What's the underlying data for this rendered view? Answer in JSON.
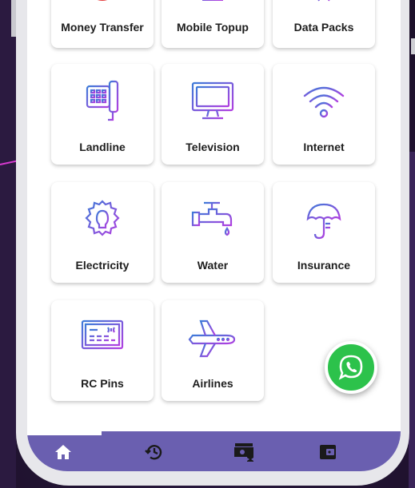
{
  "services": [
    {
      "label": "Money Transfer",
      "icon": "money-transfer-icon"
    },
    {
      "label": "Mobile Topup",
      "icon": "mobile-topup-icon"
    },
    {
      "label": "Data Packs",
      "icon": "data-packs-icon"
    },
    {
      "label": "Landline",
      "icon": "landline-phone-icon"
    },
    {
      "label": "Television",
      "icon": "television-icon"
    },
    {
      "label": "Internet",
      "icon": "wifi-icon"
    },
    {
      "label": "Electricity",
      "icon": "lightbulb-icon"
    },
    {
      "label": "Water",
      "icon": "water-tap-icon"
    },
    {
      "label": "Insurance",
      "icon": "umbrella-icon"
    },
    {
      "label": "RC Pins",
      "icon": "card-icon"
    },
    {
      "label": "Airlines",
      "icon": "airplane-icon"
    }
  ],
  "fab": {
    "icon": "whatsapp-icon"
  },
  "bottom_nav": [
    {
      "icon": "home-icon",
      "active": true
    },
    {
      "icon": "history-icon",
      "active": false
    },
    {
      "icon": "cash-icon",
      "active": false
    },
    {
      "icon": "wallet-icon",
      "active": false
    }
  ],
  "colors": {
    "accent": "#6a5fb0",
    "icon_gradient_start": "#3d7bd8",
    "icon_gradient_end": "#b03fe0",
    "whatsapp_green": "#2cc24b"
  }
}
